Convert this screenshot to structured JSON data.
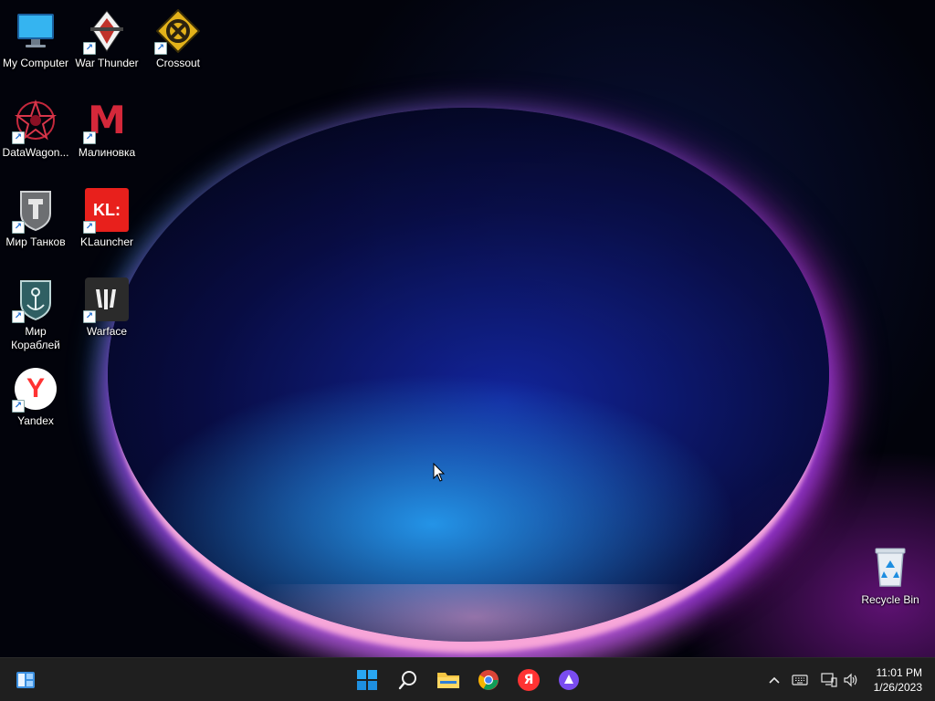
{
  "desktop": {
    "icons": [
      {
        "label": "My Computer",
        "icon": "computer-icon"
      },
      {
        "label": "War Thunder",
        "icon": "war-thunder-icon"
      },
      {
        "label": "Crossout",
        "icon": "crossout-icon"
      },
      {
        "label": "DataWagon...",
        "icon": "datawagon-icon"
      },
      {
        "label": "Малиновка",
        "icon": "malinovka-icon"
      },
      {
        "label": "Мир Танков",
        "icon": "mir-tankov-icon"
      },
      {
        "label": "KLauncher",
        "icon": "klauncher-icon"
      },
      {
        "label": "Мир\nКораблей",
        "icon": "mir-korabley-icon"
      },
      {
        "label": "Warface",
        "icon": "warface-icon"
      },
      {
        "label": "Yandex",
        "icon": "yandex-icon"
      },
      {
        "label": "Recycle Bin",
        "icon": "recycle-bin-icon"
      }
    ],
    "klauncher_logo_text": "KL:",
    "malinovka_logo_text": "M",
    "yandex_logo_text": "Y"
  },
  "taskbar": {
    "items": [
      {
        "name": "Widgets",
        "icon": "widgets-icon"
      },
      {
        "name": "Start",
        "icon": "windows-start-icon"
      },
      {
        "name": "Search",
        "icon": "search-icon"
      },
      {
        "name": "File Explorer",
        "icon": "folder-icon"
      },
      {
        "name": "Google Chrome",
        "icon": "chrome-icon"
      },
      {
        "name": "Yandex Browser",
        "icon": "yandex-browser-icon"
      },
      {
        "name": "Alice",
        "icon": "alice-icon"
      }
    ],
    "yandex_browser_glyph": "Я",
    "tray": {
      "chevron": "^",
      "time": "11:01 PM",
      "date": "1/26/2023"
    }
  },
  "colors": {
    "taskbar_bg": "#1f1f1f",
    "accent_blue": "#0a78d7",
    "klauncher_red": "#e8201c",
    "yandex_red": "#f33",
    "alice_purple": "#7a4cf0"
  }
}
